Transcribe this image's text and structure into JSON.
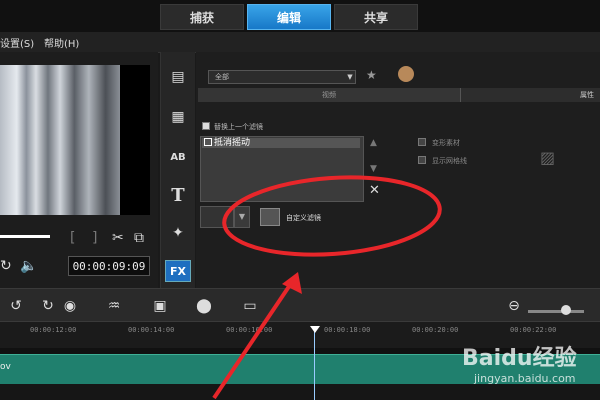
{
  "top_tabs": [
    {
      "label": "捕获",
      "active": false
    },
    {
      "label": "编辑",
      "active": true
    },
    {
      "label": "共享",
      "active": false
    }
  ],
  "menu": {
    "items": [
      "设置(S)",
      "帮助(H)"
    ]
  },
  "preview": {
    "timecode": "00:00:09:09",
    "bracket_in": "[",
    "bracket_out": "]"
  },
  "panel": {
    "dropdown_value": "全部",
    "subtab_video": "视频",
    "subtab_attr": "属性",
    "replace_last_filter_label": "替换上一个滤镜",
    "replace_last_filter_checked": true,
    "filters": [
      "抵消摇动"
    ],
    "distort_clip_label": "变形素材",
    "show_grid_label": "显示网格线",
    "custom_filter_label": "自定义滤镜"
  },
  "timeline": {
    "ticks": [
      "00:00:12:00",
      "00:00:14:00",
      "00:00:16:00",
      "00:00:18:00",
      "00:00:20:00",
      "00:00:22:00"
    ],
    "track_label": "ov"
  },
  "watermark": {
    "brand": "Baidu经验",
    "url": "jingyan.baidu.com"
  },
  "colors": {
    "accent_tab": "#1e87d8",
    "track": "#20806e",
    "annotation": "#e8262a"
  }
}
